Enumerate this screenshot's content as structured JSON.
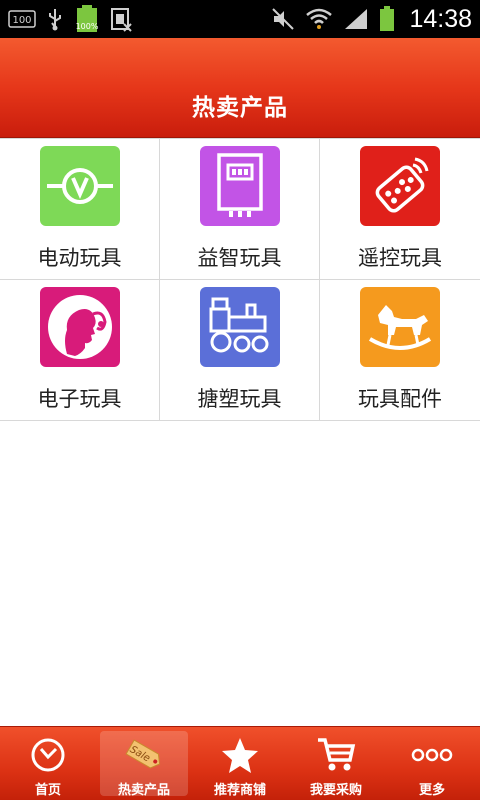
{
  "status_bar": {
    "left_badge": "100",
    "battery_pct": "100%",
    "time": "14:38"
  },
  "header": {
    "title": "热卖产品"
  },
  "categories": [
    {
      "label": "电动玩具",
      "icon": "voltmeter-icon",
      "color": "#7ed957"
    },
    {
      "label": "益智玩具",
      "icon": "meter-device-icon",
      "color": "#c254e6"
    },
    {
      "label": "遥控玩具",
      "icon": "remote-control-icon",
      "color": "#e0201a"
    },
    {
      "label": "电子玩具",
      "icon": "girl-silhouette-icon",
      "color": "#d81b7a"
    },
    {
      "label": "搪塑玩具",
      "icon": "toy-train-icon",
      "color": "#5b6fd8"
    },
    {
      "label": "玩具配件",
      "icon": "rocking-horse-icon",
      "color": "#f59a1e"
    }
  ],
  "bottom_nav": [
    {
      "label": "首页",
      "icon": "clock-icon",
      "active": false
    },
    {
      "label": "热卖产品",
      "icon": "sale-tag-icon",
      "active": true
    },
    {
      "label": "推荐商铺",
      "icon": "star-icon",
      "active": false
    },
    {
      "label": "我要采购",
      "icon": "cart-icon",
      "active": false
    },
    {
      "label": "更多",
      "icon": "more-dots-icon",
      "active": false
    }
  ],
  "colors": {
    "header_red": "#e6371a",
    "nav_red": "#dc3214"
  }
}
